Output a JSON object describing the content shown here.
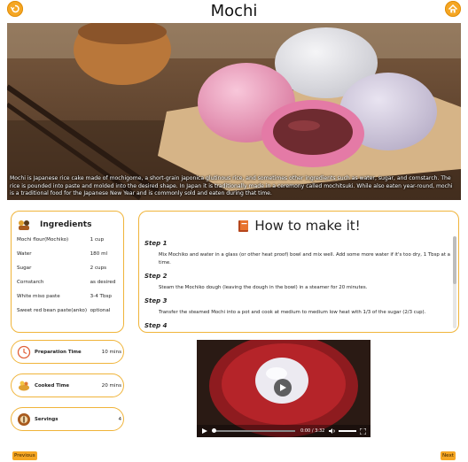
{
  "header": {
    "title": "Mochi"
  },
  "hero": {
    "description": "Mochi is Japanese rice cake made of mochigome, a short-grain japonica glutinous rice, and sometimes other ingredients such as water, sugar, and cornstarch. The rice is pounded into paste and molded into the desired shape. In Japan it is traditionally made in a ceremony called mochitsuki. While also eaten year-round, mochi is a traditional food for the Japanese New Year and is commonly sold and eaten during that time."
  },
  "ingredients": {
    "title": "Ingredients",
    "items": [
      {
        "name": "Mochi flour(Mochiko)",
        "qty": "1 cup"
      },
      {
        "name": "Water",
        "qty": "180 ml"
      },
      {
        "name": "Sugar",
        "qty": "2 cups"
      },
      {
        "name": "Cornstarch",
        "qty": "as desired"
      },
      {
        "name": "White miso paste",
        "qty": "3-4 Tbsp"
      },
      {
        "name": "Sweet red bean paste(anko)",
        "qty": "optional"
      }
    ]
  },
  "info": {
    "prep": {
      "label": "Preparation Time",
      "value": "10 mins"
    },
    "cook": {
      "label": "Cooked Time",
      "value": "20 mins"
    },
    "serv": {
      "label": "Servings",
      "value": "4"
    }
  },
  "howto": {
    "title": "How to make it!",
    "steps": [
      {
        "heading": "Step 1",
        "text": "Mix Mochiko and water in a glass (or other heat proof) bowl and mix well. Add some more water if it's too dry, 1 Tbsp at a time."
      },
      {
        "heading": "Step 2",
        "text": "Steam the Mochiko dough (leaving the dough in the bowl) in a steamer for 20 minutes."
      },
      {
        "heading": "Step 3",
        "text": "Transfer the steamed Mochi into a pot and cook at medium to medium low heat with 1/3 of the sugar (2/3 cup)."
      },
      {
        "heading": "Step 4",
        "text": ""
      }
    ]
  },
  "video": {
    "time": "0:00 / 3:32",
    "progress": 0.0
  },
  "nav": {
    "previous": "Previous",
    "next": "Next"
  },
  "colors": {
    "accent": "#f5a623",
    "border": "#f0b43a"
  },
  "icons": {
    "back": "back-arrow-icon",
    "home": "home-icon",
    "clock": "clock-icon",
    "cook": "cook-icon",
    "serving": "serving-icon",
    "play": "play-icon"
  }
}
